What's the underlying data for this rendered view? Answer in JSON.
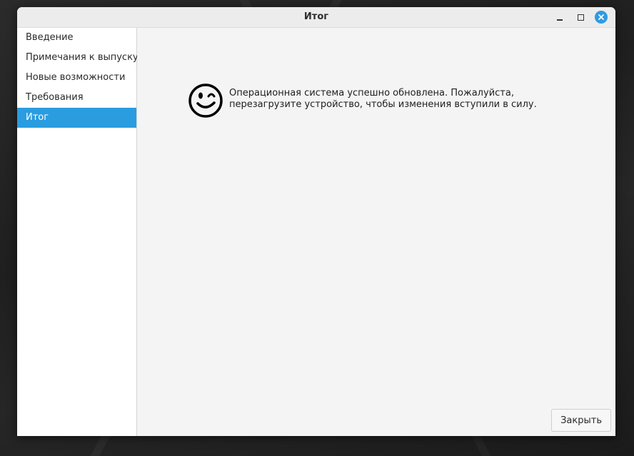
{
  "window": {
    "title": "Итог"
  },
  "sidebar": {
    "items": [
      {
        "label": "Введение",
        "active": false
      },
      {
        "label": "Примечания к выпуску",
        "active": false
      },
      {
        "label": "Новые возможности",
        "active": false
      },
      {
        "label": "Требования",
        "active": false
      },
      {
        "label": "Итог",
        "active": true
      }
    ]
  },
  "main": {
    "icon": "wink-smiley-icon",
    "message": "Операционная система успешно обновлена. Пожалуйста, перезагрузите устройство, чтобы изменения вступили в силу.",
    "close_label": "Закрыть"
  },
  "colors": {
    "accent": "#2a9ce0",
    "close_button": "#2f9be0",
    "content_bg": "#f4f4f4",
    "sidebar_bg": "#ffffff"
  }
}
